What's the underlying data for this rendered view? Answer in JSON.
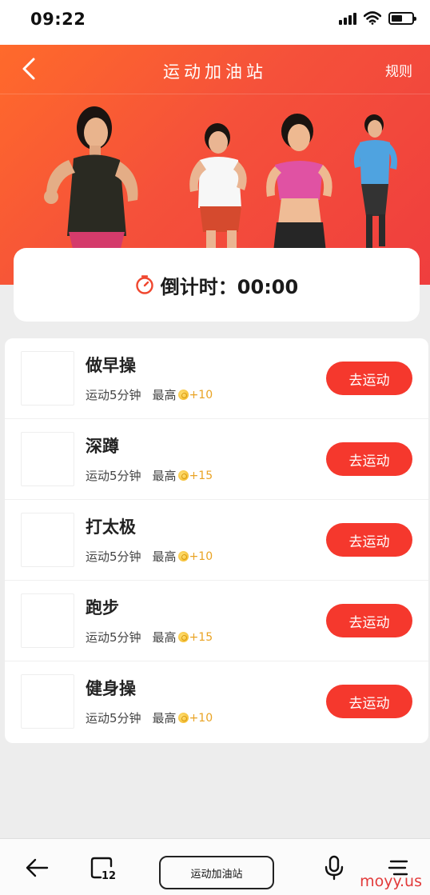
{
  "status_bar": {
    "time": "09:22"
  },
  "header": {
    "title": "运动加油站",
    "rules_label": "规则"
  },
  "countdown": {
    "label": "倒计时：00:00"
  },
  "tasks": [
    {
      "name": "做早操",
      "duration": "运动5分钟",
      "max_label": "最高",
      "reward": "+10",
      "button": "去运动"
    },
    {
      "name": "深蹲",
      "duration": "运动5分钟",
      "max_label": "最高",
      "reward": "+15",
      "button": "去运动"
    },
    {
      "name": "打太极",
      "duration": "运动5分钟",
      "max_label": "最高",
      "reward": "+10",
      "button": "去运动"
    },
    {
      "name": "跑步",
      "duration": "运动5分钟",
      "max_label": "最高",
      "reward": "+15",
      "button": "去运动"
    },
    {
      "name": "健身操",
      "duration": "运动5分钟",
      "max_label": "最高",
      "reward": "+10",
      "button": "去运动"
    }
  ],
  "browser_bar": {
    "title": "运动加油站",
    "tab_count": "12"
  },
  "watermark": "moyy.us",
  "colors": {
    "accent": "#f5382d",
    "hero_start": "#ff6a2b",
    "hero_end": "#ef3e3e",
    "reward": "#e9a324"
  },
  "icons": [
    "back-icon",
    "timer-icon",
    "coin-icon",
    "tabs-icon",
    "mic-icon",
    "menu-icon",
    "wifi-icon",
    "battery-icon",
    "signal-icon"
  ]
}
